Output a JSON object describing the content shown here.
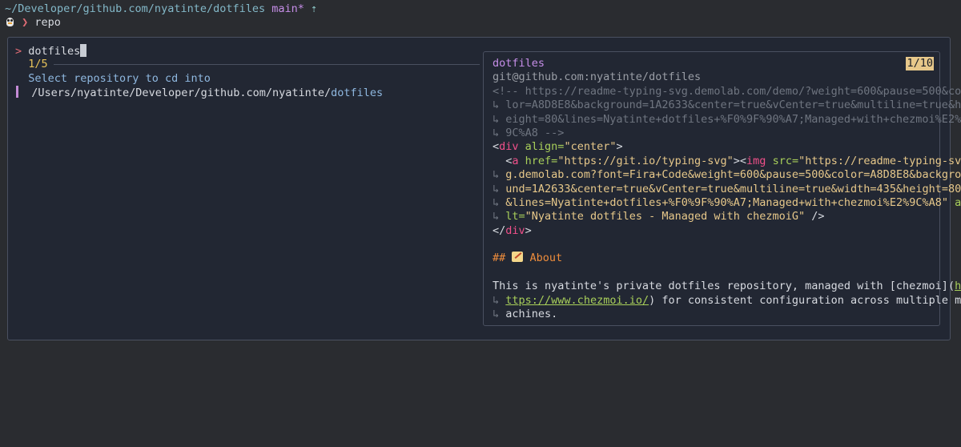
{
  "prompt": {
    "path": "~/Developer/github.com/nyatinte/dotfiles",
    "branch": "main*",
    "branch_arrow": "⇡",
    "shell_icon": "penguin-icon",
    "chevron": "❯",
    "command": "repo"
  },
  "finder": {
    "prompt_symbol": ">",
    "query": "dotfiles",
    "count": "1/5",
    "header": "Select repository to cd into",
    "selected_item_prefix": "/Users/nyatinte/Developer/github.com/nyatinte/",
    "selected_item_match": "dotfiles"
  },
  "preview": {
    "title": "dotfiles",
    "badge": "1/10",
    "remote": "git@github.com:nyatinte/dotfiles",
    "comment_lines": [
      "<!-- https://readme-typing-svg.demolab.com/demo/?weight=600&pause=500&co",
      "↳ lor=A8D8E8&background=1A2633&center=true&vCenter=true&multiline=true&h",
      "↳ eight=80&lines=Nyatinte+dotfiles+%F0%9F%90%A7;Managed+with+chezmoi%E2%",
      "↳ 9C%A8 -->"
    ],
    "div_open": {
      "lt": "<",
      "tag": "div",
      "attr": " align=",
      "val": "\"center\"",
      "gt": ">"
    },
    "a_line": {
      "indent": "  ",
      "lt": "<",
      "a_tag": "a",
      "href_attr": " href=",
      "href_val": "\"https://git.io/typing-svg\"",
      "mid": "><",
      "img_tag": "img",
      "src_attr": " src=",
      "src_val_start": "\"https://readme-typing-sv"
    },
    "wrap_lines": [
      "g.demolab.com?font=Fira+Code&weight=600&pause=500&color=A8D8E8&backgro",
      "und=1A2633&center=true&vCenter=true&multiline=true&width=435&height=80",
      "&lines=Nyatinte+dotfiles+%F0%9F%90%A7;Managed+with+chezmoi%E2%9C%A8\""
    ],
    "a_attr_tail": " a",
    "alt_line": {
      "attr": "lt=",
      "val": "\"Nyatinte dotfiles - Managed with chezmoiG\"",
      "close": " />"
    },
    "div_close": {
      "lt": "</",
      "tag": "div",
      "gt": ">"
    },
    "heading": {
      "hashes": "##",
      "icon": "memo-icon",
      "text": "About"
    },
    "para": {
      "line1_text": "This is nyatinte's private dotfiles repository, managed with [chezmoi](",
      "line1_link": "h",
      "line2_link": "ttps://www.chezmoi.io/",
      "line2_text": ") for consistent configuration across multiple m",
      "line3_text": "achines."
    },
    "wrap_marker": "↳"
  }
}
